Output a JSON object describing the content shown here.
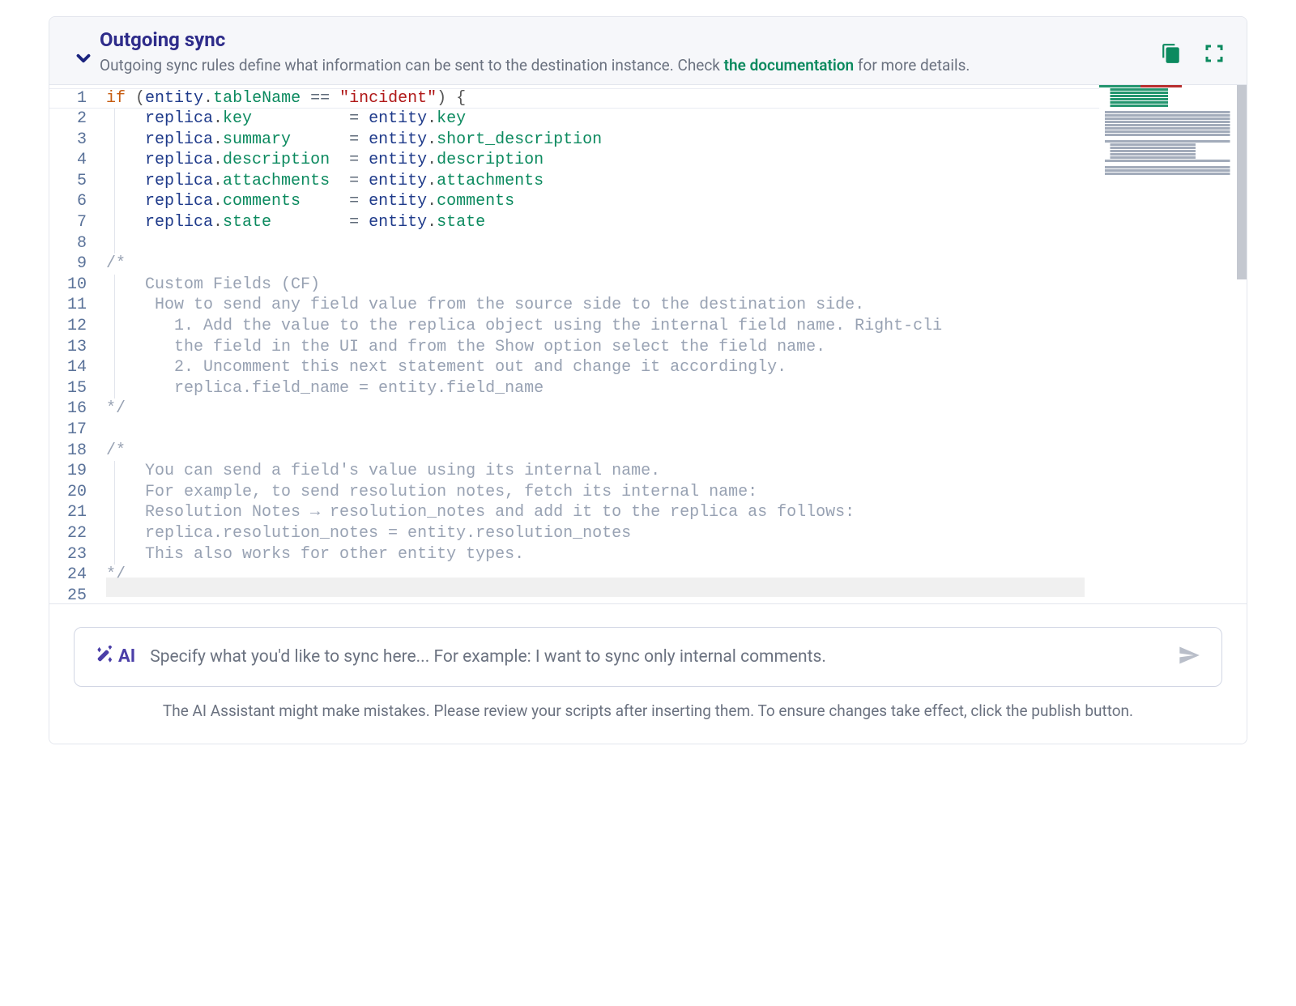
{
  "header": {
    "title": "Outgoing sync",
    "subtitle_before": "Outgoing sync rules define what information can be sent to the destination instance. Check ",
    "doc_link_text": "the documentation",
    "subtitle_after": " for more details."
  },
  "editor": {
    "lines": [
      {
        "n": 1,
        "segs": [
          {
            "t": "if ",
            "c": "tok-kw"
          },
          {
            "t": "(",
            "c": "tok-punc"
          },
          {
            "t": "entity",
            "c": "tok-obj"
          },
          {
            "t": ".",
            "c": "tok-punc"
          },
          {
            "t": "tableName",
            "c": "tok-prop"
          },
          {
            "t": " == ",
            "c": "tok-op"
          },
          {
            "t": "\"incident\"",
            "c": "tok-str"
          },
          {
            "t": ") {",
            "c": "tok-punc"
          }
        ],
        "ind": 0
      },
      {
        "n": 2,
        "segs": [
          {
            "t": "    ",
            "c": ""
          },
          {
            "t": "replica",
            "c": "tok-obj"
          },
          {
            "t": ".",
            "c": "tok-punc"
          },
          {
            "t": "key",
            "c": "tok-prop"
          },
          {
            "t": "          = ",
            "c": "tok-op"
          },
          {
            "t": "entity",
            "c": "tok-obj"
          },
          {
            "t": ".",
            "c": "tok-punc"
          },
          {
            "t": "key",
            "c": "tok-prop"
          }
        ],
        "ind": 1
      },
      {
        "n": 3,
        "segs": [
          {
            "t": "    ",
            "c": ""
          },
          {
            "t": "replica",
            "c": "tok-obj"
          },
          {
            "t": ".",
            "c": "tok-punc"
          },
          {
            "t": "summary",
            "c": "tok-prop"
          },
          {
            "t": "      = ",
            "c": "tok-op"
          },
          {
            "t": "entity",
            "c": "tok-obj"
          },
          {
            "t": ".",
            "c": "tok-punc"
          },
          {
            "t": "short_description",
            "c": "tok-prop"
          }
        ],
        "ind": 1
      },
      {
        "n": 4,
        "segs": [
          {
            "t": "    ",
            "c": ""
          },
          {
            "t": "replica",
            "c": "tok-obj"
          },
          {
            "t": ".",
            "c": "tok-punc"
          },
          {
            "t": "description",
            "c": "tok-prop"
          },
          {
            "t": "  = ",
            "c": "tok-op"
          },
          {
            "t": "entity",
            "c": "tok-obj"
          },
          {
            "t": ".",
            "c": "tok-punc"
          },
          {
            "t": "description",
            "c": "tok-prop"
          }
        ],
        "ind": 1
      },
      {
        "n": 5,
        "segs": [
          {
            "t": "    ",
            "c": ""
          },
          {
            "t": "replica",
            "c": "tok-obj"
          },
          {
            "t": ".",
            "c": "tok-punc"
          },
          {
            "t": "attachments",
            "c": "tok-prop"
          },
          {
            "t": "  = ",
            "c": "tok-op"
          },
          {
            "t": "entity",
            "c": "tok-obj"
          },
          {
            "t": ".",
            "c": "tok-punc"
          },
          {
            "t": "attachments",
            "c": "tok-prop"
          }
        ],
        "ind": 1
      },
      {
        "n": 6,
        "segs": [
          {
            "t": "    ",
            "c": ""
          },
          {
            "t": "replica",
            "c": "tok-obj"
          },
          {
            "t": ".",
            "c": "tok-punc"
          },
          {
            "t": "comments",
            "c": "tok-prop"
          },
          {
            "t": "     = ",
            "c": "tok-op"
          },
          {
            "t": "entity",
            "c": "tok-obj"
          },
          {
            "t": ".",
            "c": "tok-punc"
          },
          {
            "t": "comments",
            "c": "tok-prop"
          }
        ],
        "ind": 1
      },
      {
        "n": 7,
        "segs": [
          {
            "t": "    ",
            "c": ""
          },
          {
            "t": "replica",
            "c": "tok-obj"
          },
          {
            "t": ".",
            "c": "tok-punc"
          },
          {
            "t": "state",
            "c": "tok-prop"
          },
          {
            "t": "        = ",
            "c": "tok-op"
          },
          {
            "t": "entity",
            "c": "tok-obj"
          },
          {
            "t": ".",
            "c": "tok-punc"
          },
          {
            "t": "state",
            "c": "tok-prop"
          }
        ],
        "ind": 1
      },
      {
        "n": 8,
        "segs": [],
        "ind": 1
      },
      {
        "n": 9,
        "segs": [
          {
            "t": "/*",
            "c": "tok-cmt"
          }
        ],
        "ind": 0
      },
      {
        "n": 10,
        "segs": [
          {
            "t": "    Custom Fields (CF)",
            "c": "tok-cmt"
          }
        ],
        "ind": 1
      },
      {
        "n": 11,
        "segs": [
          {
            "t": "     How to send any field value from the source side to the destination side.",
            "c": "tok-cmt"
          }
        ],
        "ind": 1
      },
      {
        "n": 12,
        "segs": [
          {
            "t": "       1. Add the value to the replica object using the internal field name. Right-cli",
            "c": "tok-cmt"
          }
        ],
        "ind": 1
      },
      {
        "n": 13,
        "segs": [
          {
            "t": "       the field in the UI and from the Show option select the field name.",
            "c": "tok-cmt"
          }
        ],
        "ind": 1
      },
      {
        "n": 14,
        "segs": [
          {
            "t": "       2. Uncomment this next statement out and change it accordingly.",
            "c": "tok-cmt"
          }
        ],
        "ind": 1
      },
      {
        "n": 15,
        "segs": [
          {
            "t": "       replica.field_name = entity.field_name",
            "c": "tok-cmt"
          }
        ],
        "ind": 1
      },
      {
        "n": 16,
        "segs": [
          {
            "t": "*/",
            "c": "tok-cmt"
          }
        ],
        "ind": 0
      },
      {
        "n": 17,
        "segs": [],
        "ind": 0
      },
      {
        "n": 18,
        "segs": [
          {
            "t": "/*",
            "c": "tok-cmt"
          }
        ],
        "ind": 0
      },
      {
        "n": 19,
        "segs": [
          {
            "t": "    You can send a field's value using its internal name.",
            "c": "tok-cmt"
          }
        ],
        "ind": 1
      },
      {
        "n": 20,
        "segs": [
          {
            "t": "    For example, to send resolution notes, fetch its internal name:",
            "c": "tok-cmt"
          }
        ],
        "ind": 1
      },
      {
        "n": 21,
        "segs": [
          {
            "t": "    Resolution Notes → resolution_notes and add it to the replica as follows:",
            "c": "tok-cmt"
          }
        ],
        "ind": 1
      },
      {
        "n": 22,
        "segs": [
          {
            "t": "    replica.resolution_notes = entity.resolution_notes",
            "c": "tok-cmt"
          }
        ],
        "ind": 1
      },
      {
        "n": 23,
        "segs": [
          {
            "t": "    This also works for other entity types.",
            "c": "tok-cmt"
          }
        ],
        "ind": 1
      },
      {
        "n": 24,
        "segs": [
          {
            "t": "*/",
            "c": "tok-cmt"
          }
        ],
        "ind": 0
      },
      {
        "n": 25,
        "segs": [],
        "ind": 0
      }
    ]
  },
  "ai": {
    "badge": "AI",
    "placeholder": "Specify what you'd like to sync here...  For example: I want to sync only internal comments.",
    "disclaimer": "The AI Assistant might make mistakes. Please review your scripts after inserting them. To ensure changes take effect, click the publish button."
  }
}
